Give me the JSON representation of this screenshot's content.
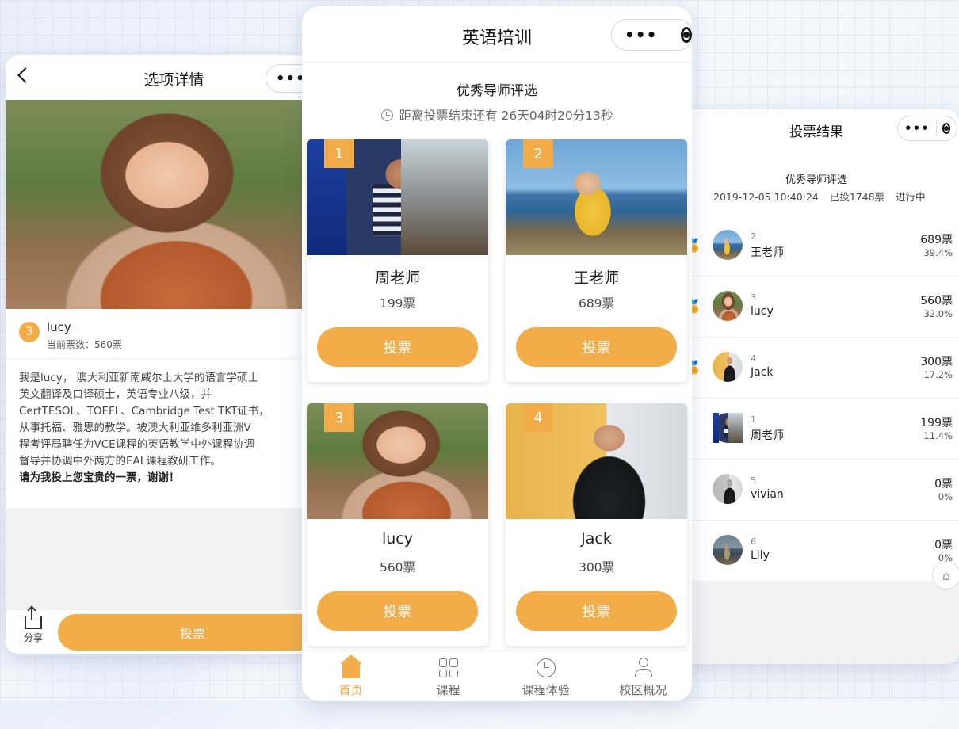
{
  "detail": {
    "title": "选项详情",
    "option_no": "3",
    "name": "lucy",
    "votes_text": "当前票数：560票",
    "description_lines": [
      "我是lucy， 澳大利亚新南威尔士大学的语言学硕士",
      "英文翻译及口译硕士，英语专业八级，并",
      "CertTESOL、TOEFL、Cambridge Test TKT证书，",
      "从事托福、雅思的教学。被澳大利亚维多利亚洲V",
      "程考评局聘任为VCE课程的英语教学中外课程协调",
      "督导并协调中外两方的EAL课程教研工作。"
    ],
    "appeal": "请为我投上您宝贵的一票，谢谢！",
    "share_label": "分享",
    "vote_label": "投票"
  },
  "main": {
    "title": "英语培训",
    "event_title": "优秀导师评选",
    "countdown": "距离投票结束还有 26天04时20分13秒",
    "vote_button": "投票",
    "cards": [
      {
        "num": "1",
        "name": "周老师",
        "votes": "199票"
      },
      {
        "num": "2",
        "name": "王老师",
        "votes": "689票"
      },
      {
        "num": "3",
        "name": "lucy",
        "votes": "560票"
      },
      {
        "num": "4",
        "name": "Jack",
        "votes": "300票"
      }
    ],
    "tabs": [
      "首页",
      "课程",
      "课程体验",
      "校区概况"
    ]
  },
  "results": {
    "title": "投票结果",
    "event_title": "优秀导师评选",
    "datetime": "2019-12-05 10:40:24",
    "total": "已投1748票",
    "status": "进行中",
    "rows": [
      {
        "rank": "2",
        "name": "王老师",
        "votes": "689票",
        "pct": "39.4%"
      },
      {
        "rank": "3",
        "name": "lucy",
        "votes": "560票",
        "pct": "32.0%"
      },
      {
        "rank": "4",
        "name": "Jack",
        "votes": "300票",
        "pct": "17.2%"
      },
      {
        "rank": "1",
        "name": "周老师",
        "votes": "199票",
        "pct": "11.4%"
      },
      {
        "rank": "5",
        "name": "vivian",
        "votes": "0票",
        "pct": "0%"
      },
      {
        "rank": "6",
        "name": "Lily",
        "votes": "0票",
        "pct": "0%"
      }
    ]
  },
  "colors": {
    "accent": "#f3ad48"
  }
}
